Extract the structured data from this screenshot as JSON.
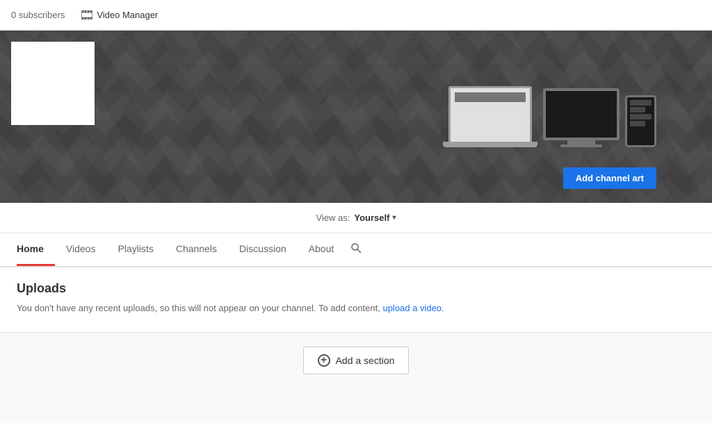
{
  "topbar": {
    "subscribers_count": "0",
    "subscribers_label": "subscribers",
    "video_manager_label": "Video Manager"
  },
  "channel": {
    "add_channel_art_label": "Add channel art"
  },
  "view_as": {
    "label": "View as:",
    "value": "Yourself"
  },
  "tabs": [
    {
      "id": "home",
      "label": "Home",
      "active": true
    },
    {
      "id": "videos",
      "label": "Videos",
      "active": false
    },
    {
      "id": "playlists",
      "label": "Playlists",
      "active": false
    },
    {
      "id": "channels",
      "label": "Channels",
      "active": false
    },
    {
      "id": "discussion",
      "label": "Discussion",
      "active": false
    },
    {
      "id": "about",
      "label": "About",
      "active": false
    }
  ],
  "uploads": {
    "title": "Uploads",
    "description": "You don't have any recent uploads, so this will not appear on your channel. To add content,",
    "link_text": "upload a video.",
    "link_suffix": ""
  },
  "add_section": {
    "label": "Add a section"
  }
}
